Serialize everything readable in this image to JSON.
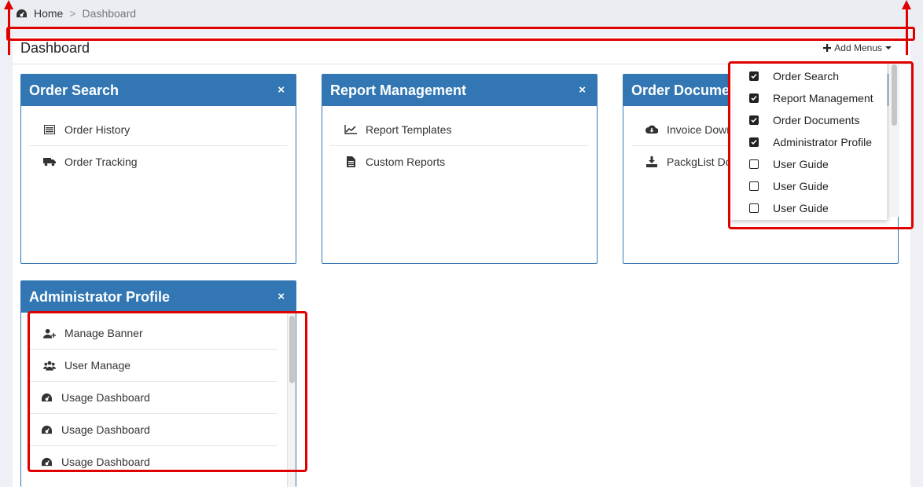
{
  "breadcrumb": {
    "home": "Home",
    "separator": ">",
    "current": "Dashboard"
  },
  "page": {
    "title": "Dashboard",
    "add_menus_label": "Add Menus"
  },
  "panels": [
    {
      "title": "Order Search",
      "close": "×",
      "items": [
        {
          "label": "Order History",
          "icon": "list-icon"
        },
        {
          "label": "Order Tracking",
          "icon": "truck-icon"
        }
      ]
    },
    {
      "title": "Report Management",
      "close": "×",
      "items": [
        {
          "label": "Report Templates",
          "icon": "line-chart-icon"
        },
        {
          "label": "Custom Reports",
          "icon": "file-text-icon"
        }
      ]
    },
    {
      "title": "Order Documents",
      "close": "×",
      "items": [
        {
          "label": "Invoice Download",
          "icon": "cloud-download-icon"
        },
        {
          "label": "PackgList Download",
          "icon": "download-icon"
        }
      ]
    },
    {
      "title": "Administrator Profile",
      "close": "×",
      "items": [
        {
          "label": "Manage Banner",
          "icon": "user-plus-icon"
        },
        {
          "label": "User Manage",
          "icon": "users-icon"
        },
        {
          "label": "Usage Dashboard",
          "icon": "dashboard-icon"
        },
        {
          "label": "Usage Dashboard",
          "icon": "dashboard-icon"
        },
        {
          "label": "Usage Dashboard",
          "icon": "dashboard-icon"
        }
      ]
    }
  ],
  "dropdown": {
    "items": [
      {
        "label": "Order Search",
        "checked": true
      },
      {
        "label": "Report Management",
        "checked": true
      },
      {
        "label": "Order Documents",
        "checked": true
      },
      {
        "label": "Administrator Profile",
        "checked": true
      },
      {
        "label": "User Guide",
        "checked": false
      },
      {
        "label": "User Guide",
        "checked": false
      },
      {
        "label": "User Guide",
        "checked": false
      }
    ]
  },
  "colors": {
    "panel_header": "#3277b3",
    "annotation": "#e00000",
    "background": "#eef0f5"
  }
}
